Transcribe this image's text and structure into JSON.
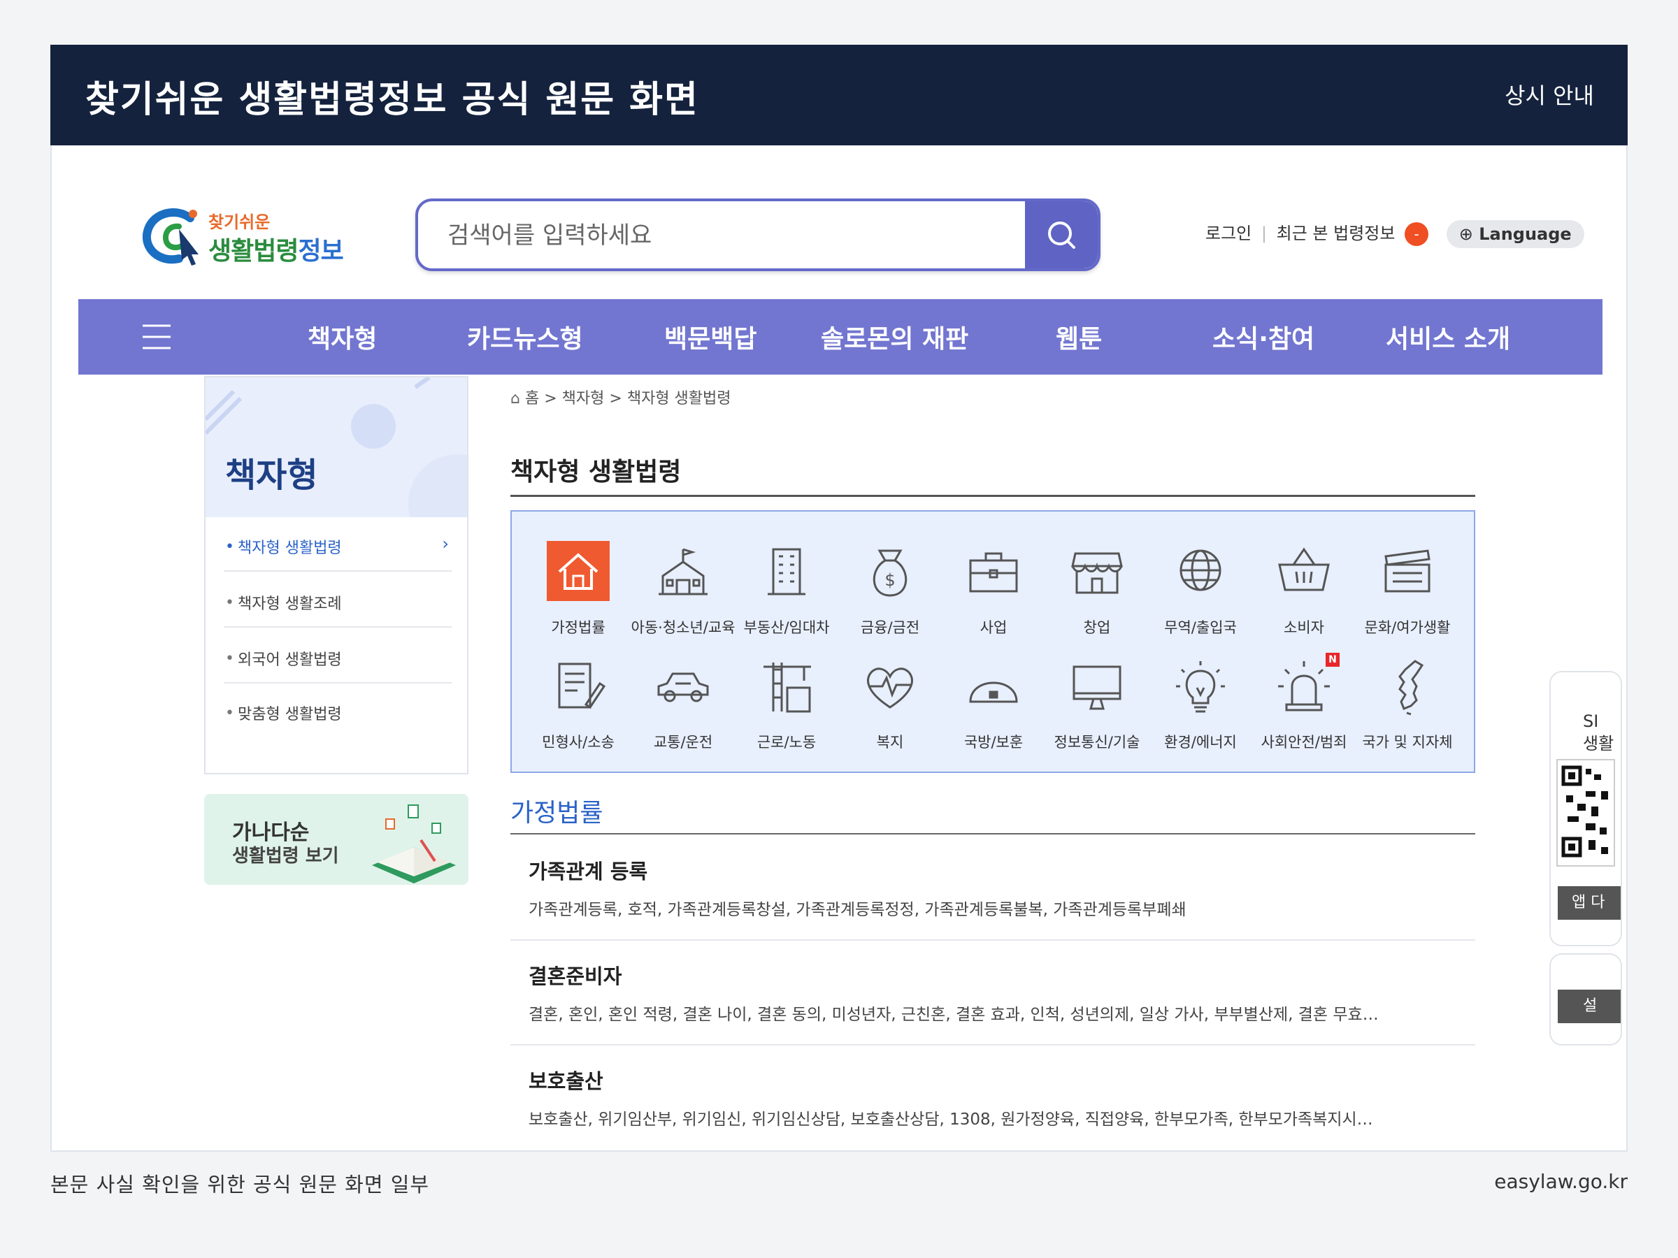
{
  "banner": {
    "title": "찾기쉬운 생활법령정보 공식 원문 화면",
    "notice": "상시 안내"
  },
  "logo": {
    "top": "찾기쉬운",
    "main_green": "생활법령",
    "main_blue": "정보"
  },
  "search": {
    "placeholder": "검색어를 입력하세요"
  },
  "top_links": {
    "login": "로그인",
    "separator": "|",
    "recent": "최근 본 법령정보",
    "recent_badge": "-",
    "language": "Language"
  },
  "gnb": {
    "items": [
      "책자형",
      "카드뉴스형",
      "백문백답",
      "솔로몬의 재판",
      "웹툰",
      "소식·참여",
      "서비스 소개"
    ]
  },
  "lnb": {
    "title": "책자형",
    "items": [
      {
        "label": "책자형 생활법령",
        "active": true
      },
      {
        "label": "책자형 생활조례",
        "active": false
      },
      {
        "label": "외국어 생활법령",
        "active": false
      },
      {
        "label": "맞춤형 생활법령",
        "active": false
      }
    ]
  },
  "ganada": {
    "line1": "가나다순",
    "line2": "생활법령 보기"
  },
  "breadcrumb": {
    "home": "홈",
    "level1": "책자형",
    "level2": "책자형 생활법령",
    "sep": ">"
  },
  "page_title": "책자형 생활법령",
  "categories": [
    {
      "label": "가정법률",
      "icon": "house-icon",
      "active": true
    },
    {
      "label": "아동·청소년/교육",
      "icon": "school-icon"
    },
    {
      "label": "부동산/임대차",
      "icon": "building-icon"
    },
    {
      "label": "금융/금전",
      "icon": "money-bag-icon"
    },
    {
      "label": "사업",
      "icon": "briefcase-icon"
    },
    {
      "label": "창업",
      "icon": "storefront-icon"
    },
    {
      "label": "무역/출입국",
      "icon": "globe-icon"
    },
    {
      "label": "소비자",
      "icon": "basket-icon"
    },
    {
      "label": "문화/여가생활",
      "icon": "clapperboard-icon"
    },
    {
      "label": "민형사/소송",
      "icon": "document-pen-icon"
    },
    {
      "label": "교통/운전",
      "icon": "car-icon"
    },
    {
      "label": "근로/노동",
      "icon": "crane-icon"
    },
    {
      "label": "복지",
      "icon": "heartbeat-icon"
    },
    {
      "label": "국방/보훈",
      "icon": "helmet-icon"
    },
    {
      "label": "정보통신/기술",
      "icon": "monitor-icon"
    },
    {
      "label": "환경/에너지",
      "icon": "lightbulb-icon"
    },
    {
      "label": "사회안전/범죄",
      "icon": "siren-icon",
      "badge": "N"
    },
    {
      "label": "국가 및 지자체",
      "icon": "korea-map-icon"
    }
  ],
  "section": {
    "title": "가정법률",
    "items": [
      {
        "title": "가족관계 등록",
        "desc": "가족관계등록, 호적, 가족관계등록창설, 가족관계등록정정, 가족관계등록불복, 가족관계등록부폐쇄"
      },
      {
        "title": "결혼준비자",
        "desc": "결혼, 혼인, 혼인 적령, 결혼 나이, 결혼 동의, 미성년자, 근친혼, 결혼 효과, 인척, 성년의제, 일상 가사, 부부별산제, 결혼 무효…"
      },
      {
        "title": "보호출산",
        "desc": "보호출산, 위기임산부, 위기임신, 위기임신상담, 보호출산상담, 1308, 원가정양육, 직접양육, 한부모가족, 한부모가족복지시…"
      }
    ]
  },
  "side": {
    "sns_line1": "SI",
    "sns_line2": "생활",
    "app": "앱 다",
    "settings": "설"
  },
  "caption": {
    "left": "본문 사실 확인을 위한 공식 원문 화면 일부",
    "right": "easylaw.go.kr"
  },
  "colors": {
    "banner": "#14223d",
    "gnb": "#7276d0",
    "accent": "#2c63c8",
    "active_icon": "#f05a30"
  }
}
